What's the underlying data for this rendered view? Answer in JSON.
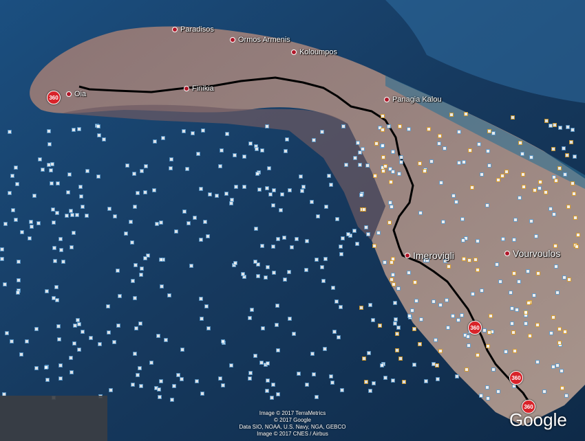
{
  "places": [
    {
      "id": "paradisos",
      "label": "Paradisos"
    },
    {
      "id": "ormos",
      "label": "Ormos Armenis"
    },
    {
      "id": "koloumpos",
      "label": "Koloumpos"
    },
    {
      "id": "oia",
      "label": "Oia"
    },
    {
      "id": "finikia",
      "label": "Finikia"
    },
    {
      "id": "panagia",
      "label": "Panagia Kalou"
    },
    {
      "id": "imerovigli",
      "label": "Imerovigli"
    },
    {
      "id": "vourvoulos",
      "label": "Vourvoulos"
    }
  ],
  "pin360_label": "360",
  "attribution": {
    "line1": "Image © 2017 TerraMetrics",
    "line2": "© 2017 Google",
    "line3": "Data SIO, NOAA, U.S. Navy, NGA, GEBCO",
    "line4": "Image © 2017 CNES / Airbus"
  },
  "logo": "Google",
  "colors": {
    "sea": "#0d2a4a",
    "land": "#8a6e6e",
    "route": "#000000",
    "pin": "#d8232a"
  }
}
